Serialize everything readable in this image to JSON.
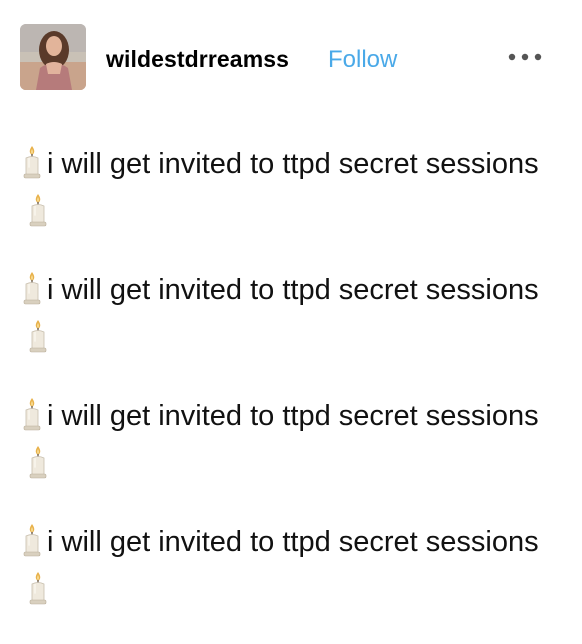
{
  "post": {
    "author": {
      "username": "wildestdrreamss",
      "follow_label": "Follow"
    },
    "more_icon": "more-horizontal-icon",
    "paragraphs": [
      {
        "text": "i will get invited to ttpd secret sessions",
        "emoji": "candle"
      },
      {
        "text": "i will get invited to ttpd secret sessions",
        "emoji": "candle"
      },
      {
        "text": "i will get invited to ttpd secret sessions",
        "emoji": "candle"
      },
      {
        "text": "i will get invited to ttpd secret sessions",
        "emoji": "candle"
      }
    ]
  },
  "colors": {
    "follow": "#4aa9e8",
    "text": "#111111",
    "background": "#ffffff"
  }
}
